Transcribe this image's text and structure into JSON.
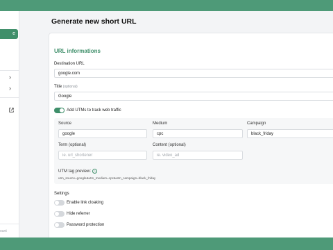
{
  "sidebar": {
    "button_label": "e",
    "footer_text": "ount"
  },
  "page": {
    "title": "Generate new short URL"
  },
  "form": {
    "section_title": "URL informations",
    "destination": {
      "label": "Destination URL",
      "value": "google.com"
    },
    "title": {
      "label": "Title",
      "optional": "(optional)",
      "value": "Google"
    },
    "utm_toggle": {
      "label": "Add UTMs to track web traffic",
      "on": true
    },
    "utm": {
      "source": {
        "label": "Source",
        "value": "google"
      },
      "medium": {
        "label": "Medium",
        "value": "cpc"
      },
      "campaign": {
        "label": "Campaign",
        "value": "black_friday"
      },
      "term": {
        "label": "Term (optional)",
        "placeholder": "ie. url_shortener"
      },
      "content": {
        "label": "Content (optional)",
        "placeholder": "ie. video_ad"
      },
      "preview_label": "UTM tag preview:",
      "preview_value": "utm_source=google&utm_medium=cpc&utm_campaign=black_friday"
    },
    "settings": {
      "title": "Settings",
      "items": [
        {
          "label": "Enable link cloaking",
          "on": false
        },
        {
          "label": "Hide referrer",
          "on": false
        },
        {
          "label": "Password protection",
          "on": false
        }
      ]
    }
  },
  "colors": {
    "accent": "#3f8f6a",
    "frame": "#4e9a78"
  }
}
